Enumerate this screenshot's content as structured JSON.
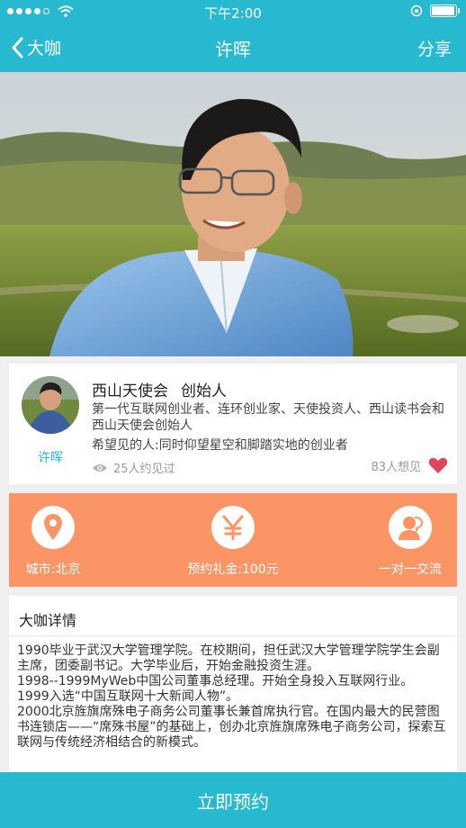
{
  "status_bar": {
    "time": "下午2:00"
  },
  "nav": {
    "back_label": "大咖",
    "title": "许晖",
    "share_label": "分享"
  },
  "profile": {
    "name": "许晖",
    "org": "西山天使会",
    "role": "创始人",
    "bio": "第一代互联网创业者、连环创业家、天使投资人、西山读书会和西山天使会创始人",
    "hope": "希望见的人:同时仰望星空和脚踏实地的创业者",
    "met_count": "25人约见过",
    "want_count": "83人想见"
  },
  "features": [
    {
      "label": "城市:北京",
      "icon": "location-pin-icon"
    },
    {
      "label": "预约礼金:100元",
      "icon": "yen-icon"
    },
    {
      "label": "一对一交流",
      "icon": "person-chat-icon"
    }
  ],
  "detail": {
    "title": "大咖详情",
    "paragraphs": [
      "1990毕业于武汉大学管理学院。在校期间，担任武汉大学管理学院学生会副主席，团委副书记。大学毕业后，开始金融投资生涯。",
      "1998--1999MyWeb中国公司董事总经理。开始全身投入互联网行业。",
      "1999入选“中国互联网十大新闻人物”。",
      "2000北京旌旗席殊电子商务公司董事长兼首席执行官。在国内最大的民营图书连锁店——“席殊书屋”的基础上，创办北京旌旗席殊电子商务公司，探索互联网与传统经济相结合的新模式。"
    ]
  },
  "book_button": "立即预约",
  "colors": {
    "brand": "#27b9cf",
    "accent": "#fc9566",
    "heart": "#e0455e"
  }
}
